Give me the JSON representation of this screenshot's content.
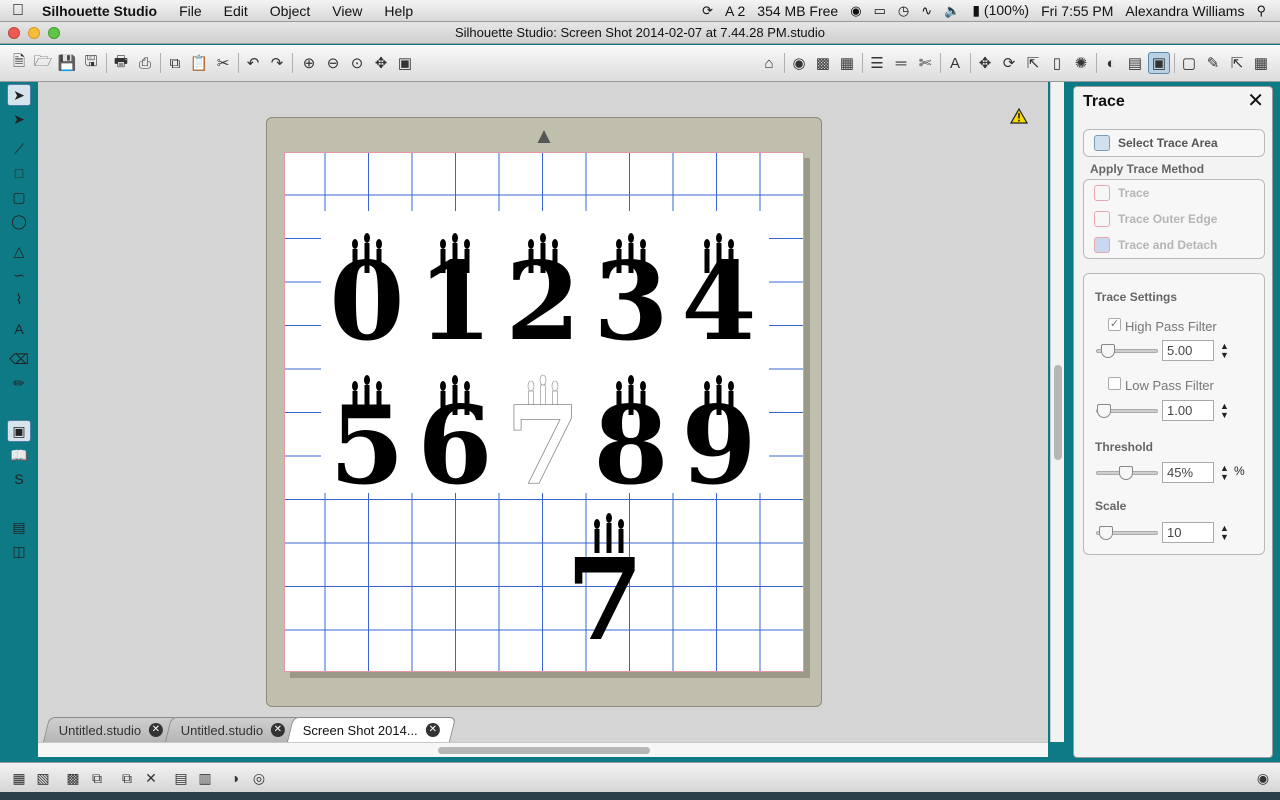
{
  "menubar": {
    "app_name": "Silhouette Studio",
    "menus": [
      "File",
      "Edit",
      "Object",
      "View",
      "Help"
    ],
    "status_adobe_badge": "2",
    "memory": "354 MB Free",
    "battery": "(100%)",
    "clock": "Fri 7:55 PM",
    "user": "Alexandra Williams"
  },
  "window": {
    "title": "Silhouette Studio: Screen Shot 2014-02-07 at 7.44.28 PM.studio"
  },
  "tabs": [
    {
      "label": "Untitled.studio",
      "active": false
    },
    {
      "label": "Untitled.studio",
      "active": false
    },
    {
      "label": "Screen Shot 2014...",
      "active": true
    }
  ],
  "panel": {
    "title": "Trace",
    "select_trace_area": "Select Trace Area",
    "apply_trace_method": "Apply Trace Method",
    "methods": [
      "Trace",
      "Trace Outer Edge",
      "Trace and Detach"
    ],
    "trace_settings": "Trace Settings",
    "high_pass_label": "High Pass Filter",
    "high_pass_checked": true,
    "high_pass_value": "5.00",
    "low_pass_label": "Low Pass Filter",
    "low_pass_checked": false,
    "low_pass_value": "1.00",
    "threshold_label": "Threshold",
    "threshold_value": "45%",
    "threshold_unit": "%",
    "scale_label": "Scale",
    "scale_value": "10"
  },
  "canvas": {
    "digits_row1": [
      "0",
      "1",
      "2",
      "3",
      "4"
    ],
    "digits_row2": [
      "5",
      "6",
      "7",
      "8",
      "9"
    ],
    "traced_digit": "7"
  },
  "colors": {
    "accent_teal": "#0e7a86",
    "grid_blue": "#3a64d6",
    "mat_tan": "#c0bfad"
  }
}
